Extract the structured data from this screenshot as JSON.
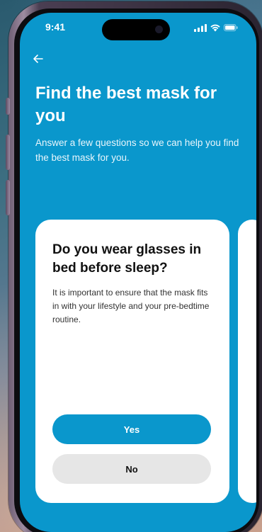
{
  "status_bar": {
    "time": "9:41"
  },
  "header": {
    "back_icon": "arrow-left-icon",
    "title": "Find the best mask for you",
    "subtitle": "Answer a few questions so we can help you find the best mask for you."
  },
  "question_card": {
    "question": "Do you wear glasses in bed before sleep?",
    "description": "It is important to ensure that the mask fits in with your lifestyle and your pre-bedtime routine.",
    "yes_label": "Yes",
    "no_label": "No"
  },
  "colors": {
    "primary": "#0a97cc",
    "card_background": "#ffffff",
    "secondary_button": "#e6e6e6"
  }
}
